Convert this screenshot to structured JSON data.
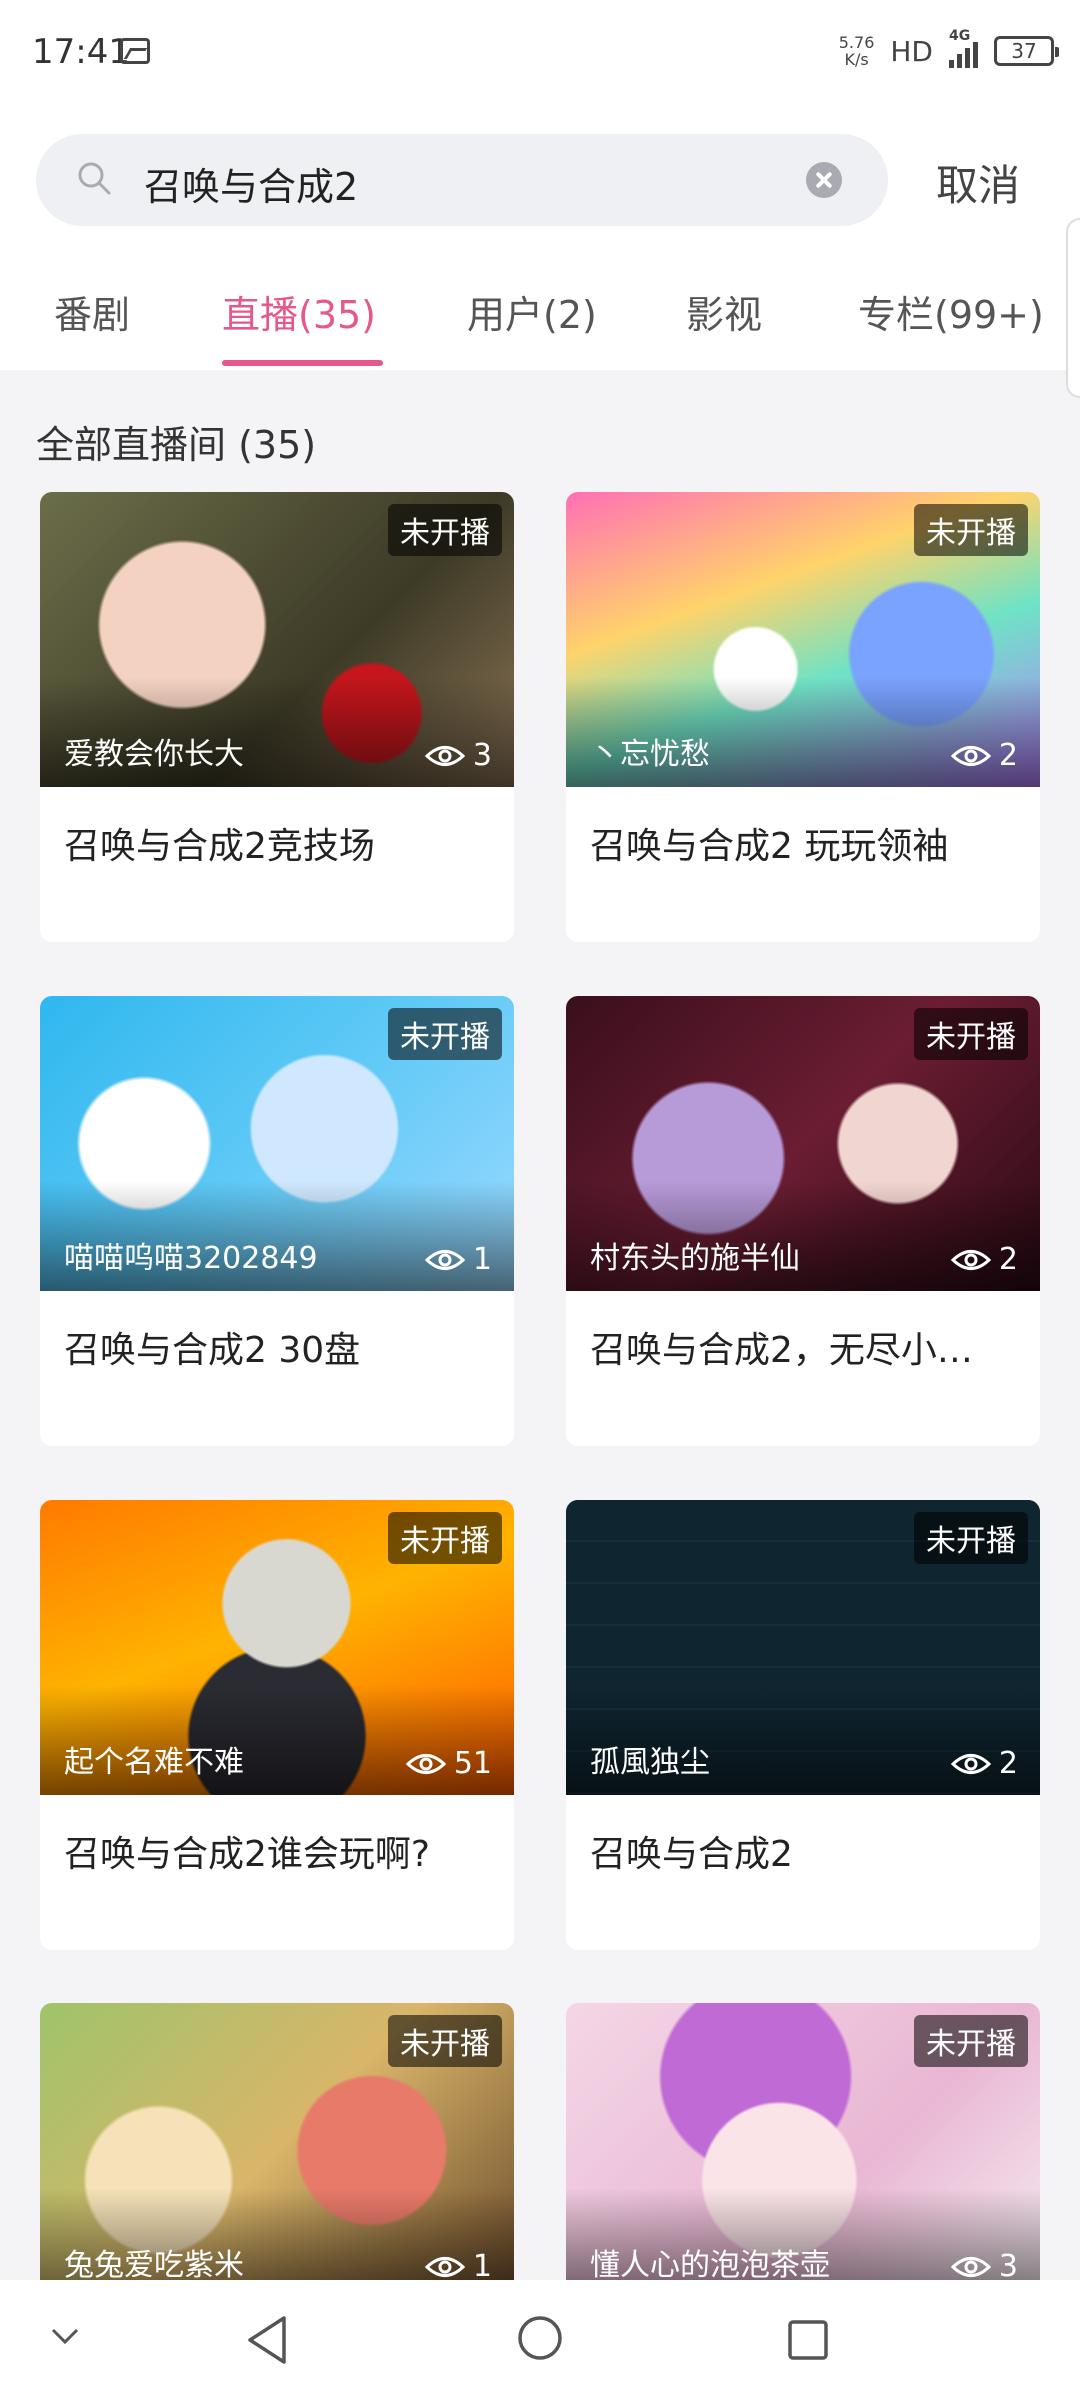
{
  "status_bar": {
    "time": "17:41",
    "net_speed_value": "5.76",
    "net_speed_unit": "K/s",
    "hd": "HD",
    "network": "4G",
    "battery": "37"
  },
  "search": {
    "query": "召唤与合成2",
    "cancel_label": "取消"
  },
  "tabs": [
    {
      "label": "番剧",
      "active": false
    },
    {
      "label": "直播(35)",
      "active": true
    },
    {
      "label": "用户(2)",
      "active": false
    },
    {
      "label": "影视",
      "active": false
    },
    {
      "label": "专栏(99+)",
      "active": false
    }
  ],
  "section_title": "全部直播间 (35)",
  "cards": [
    {
      "badge": "未开播",
      "uploader": "爱教会你长大",
      "views": "3",
      "title": "召唤与合成2竞技场"
    },
    {
      "badge": "未开播",
      "uploader": "丶忘忧愁",
      "views": "2",
      "title": "召唤与合成2  玩玩领袖"
    },
    {
      "badge": "未开播",
      "uploader": "喵喵呜喵3202849",
      "views": "1",
      "title": "召唤与合成2 30盘"
    },
    {
      "badge": "未开播",
      "uploader": "村东头的施半仙",
      "views": "2",
      "title": "召唤与合成2，无尽小…"
    },
    {
      "badge": "未开播",
      "uploader": "起个名难不难",
      "views": "51",
      "title": "召唤与合成2谁会玩啊?"
    },
    {
      "badge": "未开播",
      "uploader": "孤風独尘",
      "views": "2",
      "title": "召唤与合成2"
    },
    {
      "badge": "未开播",
      "uploader": "兔兔爱吃紫米",
      "views": "1",
      "title": ""
    },
    {
      "badge": "未开播",
      "uploader": "懂人心的泡泡茶壶",
      "views": "3",
      "title": ""
    }
  ],
  "colors": {
    "accent": "#e6578c",
    "background": "#f4f4f6"
  }
}
